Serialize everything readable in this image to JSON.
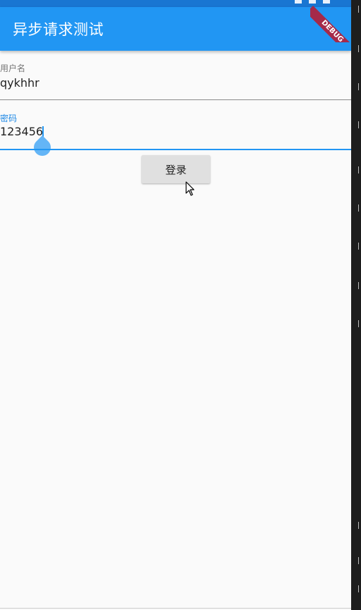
{
  "app_bar": {
    "title": "异步请求测试"
  },
  "debug_banner": {
    "label": "DEBUG"
  },
  "form": {
    "username": {
      "label": "用户名",
      "value": "qykhhr"
    },
    "password": {
      "label": "密码",
      "value": "123456"
    },
    "login_label": "登录"
  },
  "colors": {
    "primary": "#2196f3",
    "status_bar": "#1976d2",
    "focus_label": "#1e88e5",
    "debug_ribbon": "#a52a4a",
    "button_bg": "#e0e0e0",
    "background": "#fafafa"
  },
  "icons": {
    "status": [
      "wifi-icon",
      "signal-icon",
      "battery-icon"
    ],
    "pointer": "mouse-pointer-icon"
  }
}
